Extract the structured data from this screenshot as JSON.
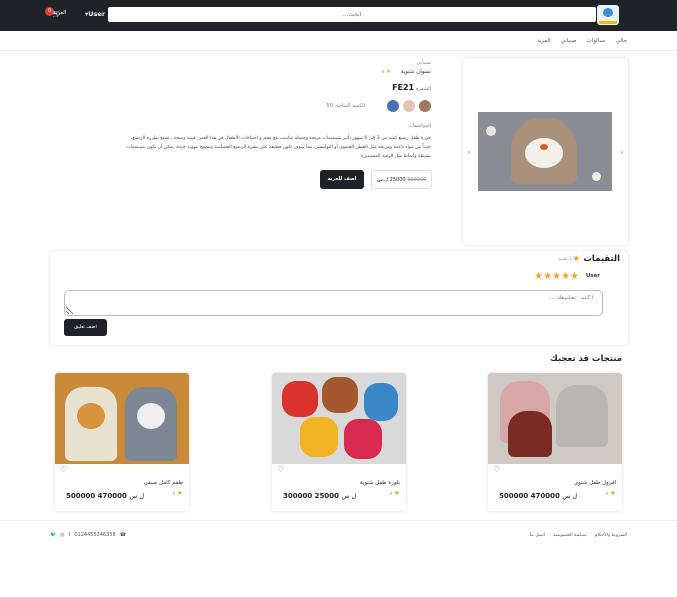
{
  "header": {
    "search_placeholder": "ابحث...",
    "user_label": "User▾",
    "cart_count": "0",
    "cart_label": "العربة",
    "icon_logo": "happy-kids-logo",
    "icon_cart": "cart-icon"
  },
  "nav": {
    "items": [
      "جالي",
      "سبالوات",
      "صبياني",
      "المزيد"
    ]
  },
  "product": {
    "category": "صبياني",
    "name": "نسوان شتوية",
    "rating": "4",
    "code_label": "الشفرة",
    "code": "FE21",
    "qty_label": "الكمية المتاحة:",
    "qty_value": "50",
    "colors": [
      "#a07a5d",
      "#e6c3ae",
      "#4a72b8"
    ],
    "spec_title": "المواصفات",
    "description": "جرزة طقل رضيع كمية من 3 إلى 6 شهور تأثير بتصميمات مريحة وجميلة تتناسب مع مجم و احتياجات الأطفال في هذا العمر. قيمة وصحة ، تصنع بطرزة الرضيع، جدداً من مواد ناعمة ومريحة مثل القطن العضوي أو البوليستر، مما سوف تكون قطيفة على بشرة الرضيع الحساسة وتسمح بتهوية جيدة، يمكن أن تكون بتصميمات بسيطة وأنماط مثل الرقبة المستديرة",
    "price_new": "25000",
    "price_old": "300000",
    "currency": "ل.س",
    "add_button": "اضف للعربة"
  },
  "reviews": {
    "title": "التقيمات",
    "rating": "5",
    "count": "1 تقييم",
    "user": "User",
    "user_stars": "★★★★★",
    "placeholder": "اكتب تعليقك...",
    "submit": "اضف تعليق"
  },
  "suggested": {
    "title": "منتجات قد تعجبك",
    "products": [
      {
        "name": "افرول طفل شتوي",
        "rating": "4",
        "price": "470000",
        "old_price": "500000",
        "currency": "ل س"
      },
      {
        "name": "بلوزة طفل شتوية",
        "rating": "4",
        "price": "25000",
        "old_price": "300000",
        "currency": "ل س"
      },
      {
        "name": "طقم كامل صيفي",
        "rating": "4",
        "price": "470000",
        "old_price": "500000",
        "currency": "ل س"
      }
    ]
  },
  "footer": {
    "links": [
      "الشروط والأحكام",
      "سياسة الخصوصية",
      "اتصل بنا"
    ],
    "phone": "0124455346358",
    "social": [
      "twitter-icon",
      "instagram-icon",
      "facebook-icon"
    ]
  }
}
